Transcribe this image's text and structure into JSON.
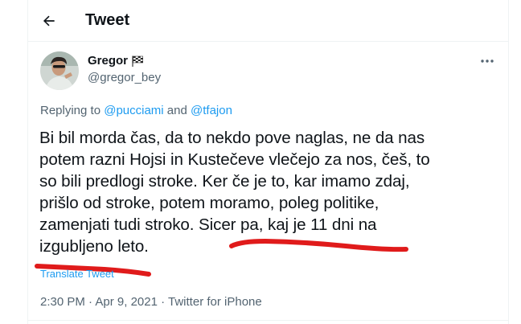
{
  "header": {
    "back_icon": "arrow-left-icon",
    "title": "Tweet"
  },
  "author": {
    "display_name": "Gregor",
    "name_emoji_icon": "chequered-flag-icon",
    "handle": "@gregor_bey",
    "avatar_icon": "profile-photo"
  },
  "more_icon": "more-horizontal-icon",
  "replying": {
    "prefix": "Replying to ",
    "mention_1": "@pucciami",
    "joiner": " and ",
    "mention_2": "@tfajon"
  },
  "tweet": {
    "lines": [
      "Bi bil morda čas, da to nekdo pove naglas, ne da nas",
      "potem razni Hojsi in Kustečeve vlečejo za nos, češ, to",
      "so bili predlogi stroke. Ker če je to, kar imamo zdaj,",
      "prišlo od stroke, potem moramo, poleg politike,",
      "zamenjati tudi stroko. Sicer pa, kaj je 11 dni na",
      "izgubljeno leto."
    ]
  },
  "translate_label": "Translate Tweet",
  "meta": {
    "time": "2:30 PM",
    "sep1": " · ",
    "date": "Apr 9, 2021",
    "sep2": " · ",
    "source": "Twitter for iPhone"
  },
  "colors": {
    "accent": "#1d9bf0",
    "text": "#0f1419",
    "secondary": "#536471",
    "annotation": "#e01b1b"
  }
}
